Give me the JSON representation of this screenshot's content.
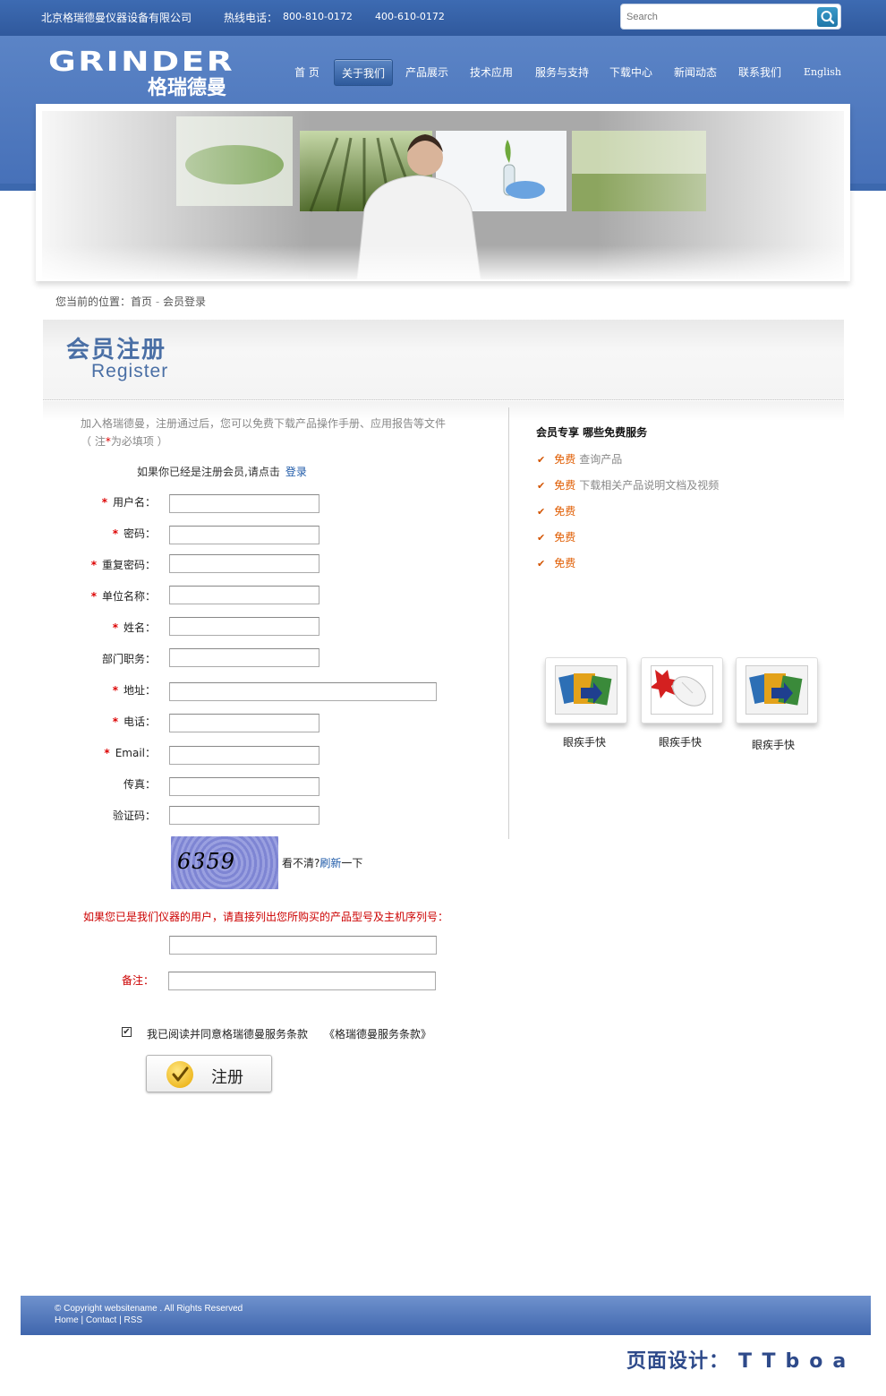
{
  "topbar": {
    "company": "北京格瑞德曼仪器设备有限公司",
    "hotline_label": "热线电话：",
    "phone1": "800-810-0172",
    "phone2": "400-610-0172",
    "search_placeholder": "Search"
  },
  "logo": {
    "en": "GRINDER",
    "cn": "格瑞德曼"
  },
  "nav": {
    "items": [
      "首 页",
      "关于我们",
      "产品展示",
      "技术应用",
      "服务与支持",
      "下载中心",
      "新闻动态",
      "联系我们",
      "English"
    ],
    "active": "关于我们"
  },
  "breadcrumb": {
    "prefix": "您当前的位置：",
    "home": "首页",
    "sep": " - ",
    "current": "会员登录"
  },
  "register_header": {
    "title_cn": "会员注册",
    "title_en": "Register"
  },
  "form": {
    "intro": "加入格瑞德曼，注册通过后，您可以免费下载产品操作手册、应用报告等文件",
    "required_note_open": "（ 注",
    "required_star": "*",
    "required_note_close": "为必填项 ）",
    "login_prompt": "如果你已经是注册会员,请点击",
    "login_link": "登录",
    "required_mark": "*",
    "fields": [
      {
        "label": "用户名："
      },
      {
        "label": "密码："
      },
      {
        "label": "重复密码："
      },
      {
        "label": "单位名称："
      },
      {
        "label": "姓名："
      },
      {
        "label": "部门职务："
      },
      {
        "label": "地址："
      },
      {
        "label": "电话："
      },
      {
        "label": "Email："
      },
      {
        "label": "传真："
      },
      {
        "label": "验证码："
      }
    ],
    "captcha_code": "6359",
    "captcha_prompt": "看不清?",
    "captcha_refresh": "刷新",
    "captcha_refresh_tail": "一下",
    "owner_note": "如果您已是我们仪器的用户，请直接列出您所购买的产品型号及主机序列号：",
    "remark_label": "备注：",
    "agree_text": "我已阅读并同意格瑞德曼服务条款",
    "agree_terms": "《格瑞德曼服务条款》",
    "agree_checked": true,
    "submit_label": "注册"
  },
  "sidebar": {
    "title": "会员专享 哪些免费服务",
    "items": [
      {
        "free": "免费",
        "desc": "查询产品"
      },
      {
        "free": "免费",
        "desc": "下载相关产品说明文档及视频"
      },
      {
        "free": "免费",
        "desc": ""
      },
      {
        "free": "免费",
        "desc": ""
      },
      {
        "free": "免费",
        "desc": ""
      }
    ],
    "thumbs": [
      {
        "caption": "眼疾手快",
        "icon": "media-files-icon"
      },
      {
        "caption": "眼疾手快",
        "icon": "mouse-click-icon"
      },
      {
        "caption": "眼疾手快",
        "icon": "media-files-icon"
      }
    ]
  },
  "footer": {
    "copyright": "© Copyright websitename . All Rights Reserved",
    "home": "Home",
    "contact": "Contact",
    "rss": "RSS",
    "sep": " | "
  },
  "credit": {
    "label": "页面设计：",
    "name": "TTboa"
  },
  "colors": {
    "brand_blue": "#4670b8",
    "link_blue": "#1f5aa8",
    "required_red": "#dd0000",
    "free_orange": "#e05c00"
  }
}
